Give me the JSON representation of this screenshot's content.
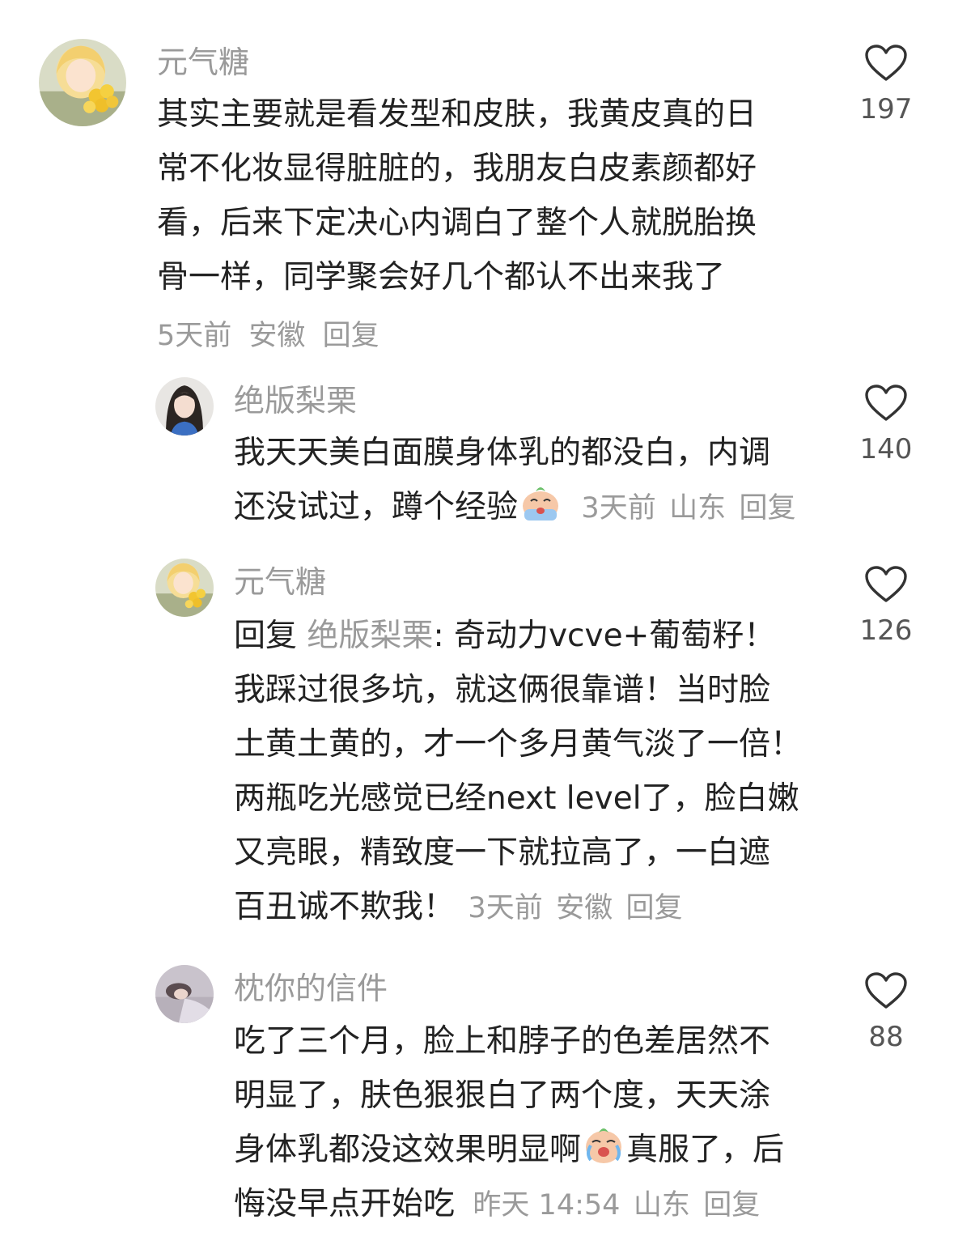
{
  "comments": [
    {
      "username": "元气糖",
      "lines": [
        "其实主要就是看发型和皮肤，我黄皮真的日",
        "常不化妆显得脏脏的，我朋友白皮素颜都好",
        "看，后来下定决心内调白了整个人就脱胎换",
        "骨一样，同学聚会好几个都认不出来我了"
      ],
      "time": "5天前",
      "location": "安徽",
      "reply": "回复",
      "likes": "197"
    },
    {
      "username": "绝版梨栗",
      "line1": "我天天美白面膜身体乳的都没白，内调",
      "line2": "还没试过，蹲个经验",
      "time": "3天前",
      "location": "山东",
      "reply": "回复",
      "likes": "140"
    },
    {
      "username": "元气糖",
      "reply_prefix": "回复",
      "reply_to": "绝版梨栗",
      "line1_rest": ": 奇动力vcve+葡萄籽！",
      "lines": [
        "我踩过很多坑，就这俩很靠谱！当时脸",
        "土黄土黄的，才一个多月黄气淡了一倍！",
        "两瓶吃光感觉已经next level了，脸白嫩",
        "又亮眼，精致度一下就拉高了，一白遮"
      ],
      "last_line": "百丑诚不欺我！",
      "time": "3天前",
      "location": "安徽",
      "reply": "回复",
      "likes": "126"
    },
    {
      "username": "枕你的信件",
      "lines": [
        "吃了三个月，脸上和脖子的色差居然不",
        "明显了，肤色狠狠白了两个度，天天涂"
      ],
      "line3a": "身体乳都没这效果明显啊",
      "line3b": "真服了，后",
      "last_line": "悔没早点开始吃",
      "time": "昨天 14:54",
      "location": "山东",
      "reply": "回复",
      "likes": "88"
    }
  ]
}
